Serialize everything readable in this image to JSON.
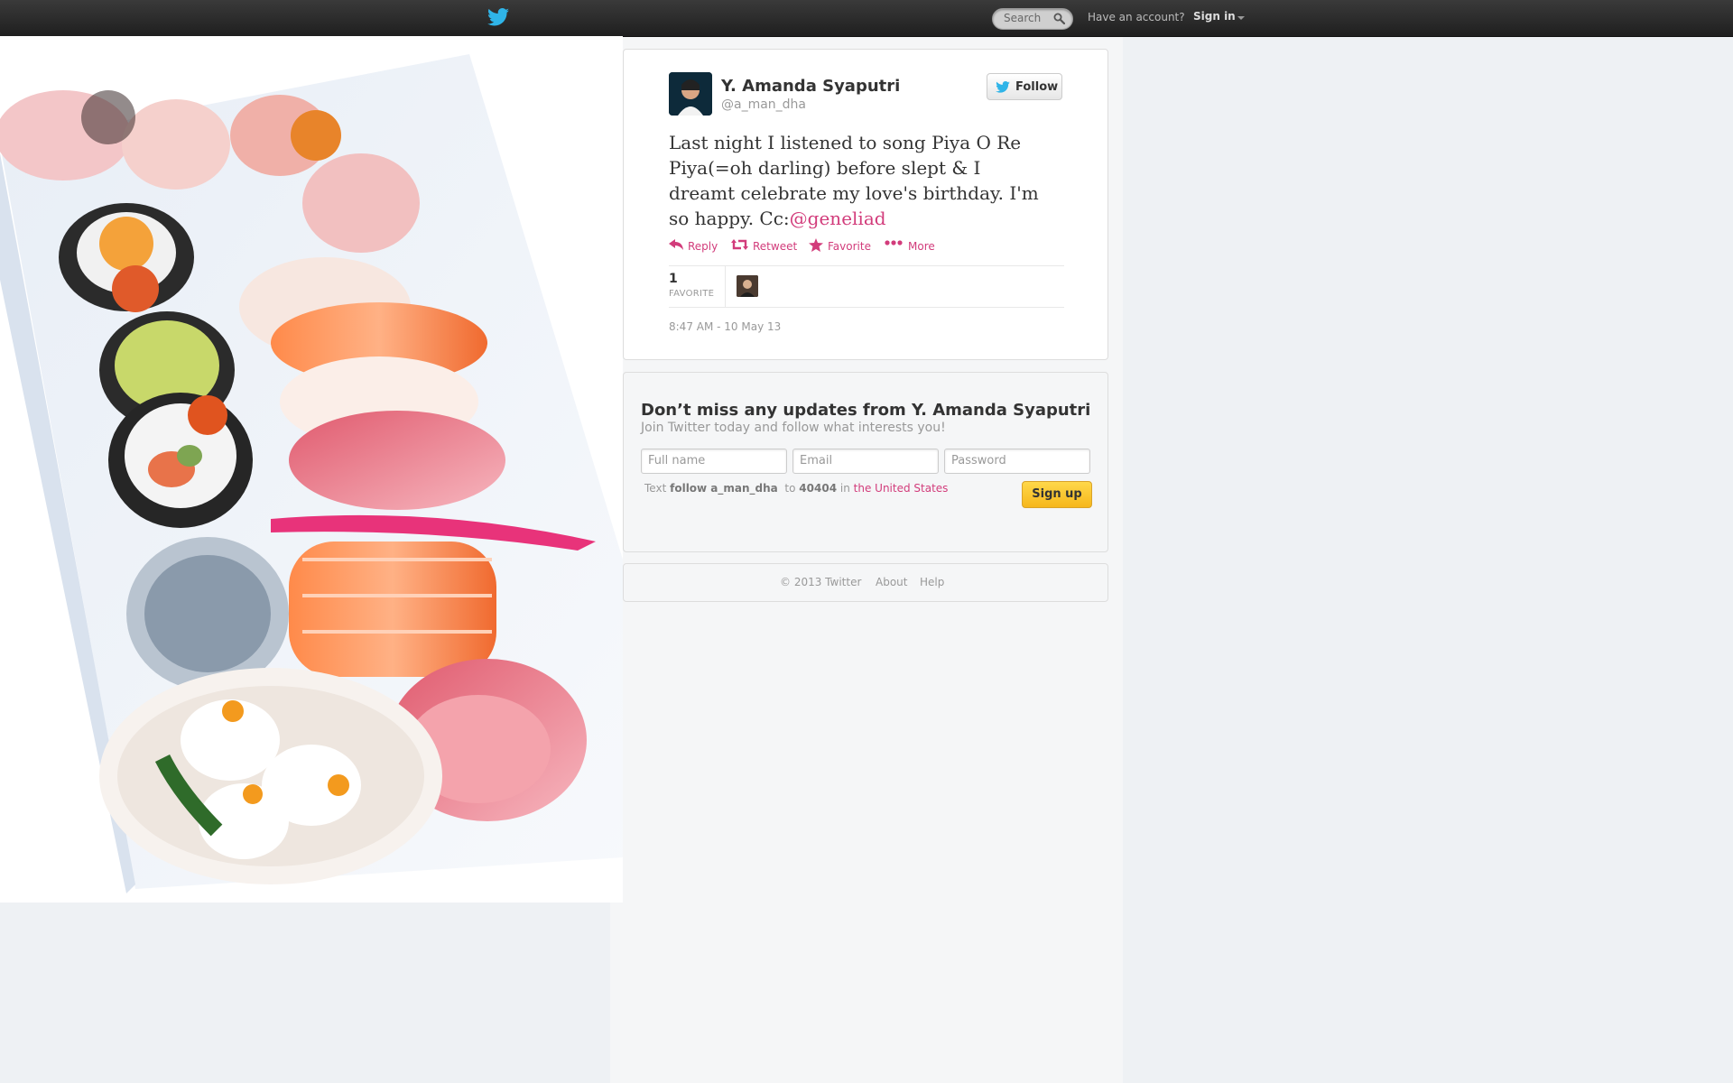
{
  "topbar": {
    "search_placeholder": "Search",
    "have_account": "Have an account?",
    "sign_in": "Sign in"
  },
  "tweet": {
    "name": "Y. Amanda Syaputri",
    "handle": "@a_man_dha",
    "follow_label": "Follow",
    "text": "Last night I listened to song Piya O Re Piya(=oh darling) before slept & I dreamt celebrate my love's birthday. I'm so happy. Cc:",
    "mention": "@geneliad",
    "actions": {
      "reply": "Reply",
      "retweet": "Retweet",
      "favorite": "Favorite",
      "more": "More"
    },
    "favorite_count": "1",
    "favorite_label": "FAVORITE",
    "timestamp": "8:47 AM - 10 May 13"
  },
  "signup": {
    "title": "Don’t miss any updates from Y. Amanda Syaputri",
    "subtitle": "Join Twitter today and follow what interests you!",
    "fullname_placeholder": "Full name",
    "email_placeholder": "Email",
    "password_placeholder": "Password",
    "sms_text": "Text",
    "sms_command": "follow a_man_dha",
    "sms_to": "to",
    "sms_number": "40404",
    "sms_in": "in",
    "sms_country": "the United States",
    "button": "Sign up"
  },
  "footer": {
    "copyright": "© 2013 Twitter",
    "about": "About",
    "help": "Help"
  },
  "colors": {
    "accent": "#d23c7b",
    "topbar": "#2a2a2a",
    "twitter_blue": "#2fb4e8",
    "signup_button": "#f6b71c"
  }
}
